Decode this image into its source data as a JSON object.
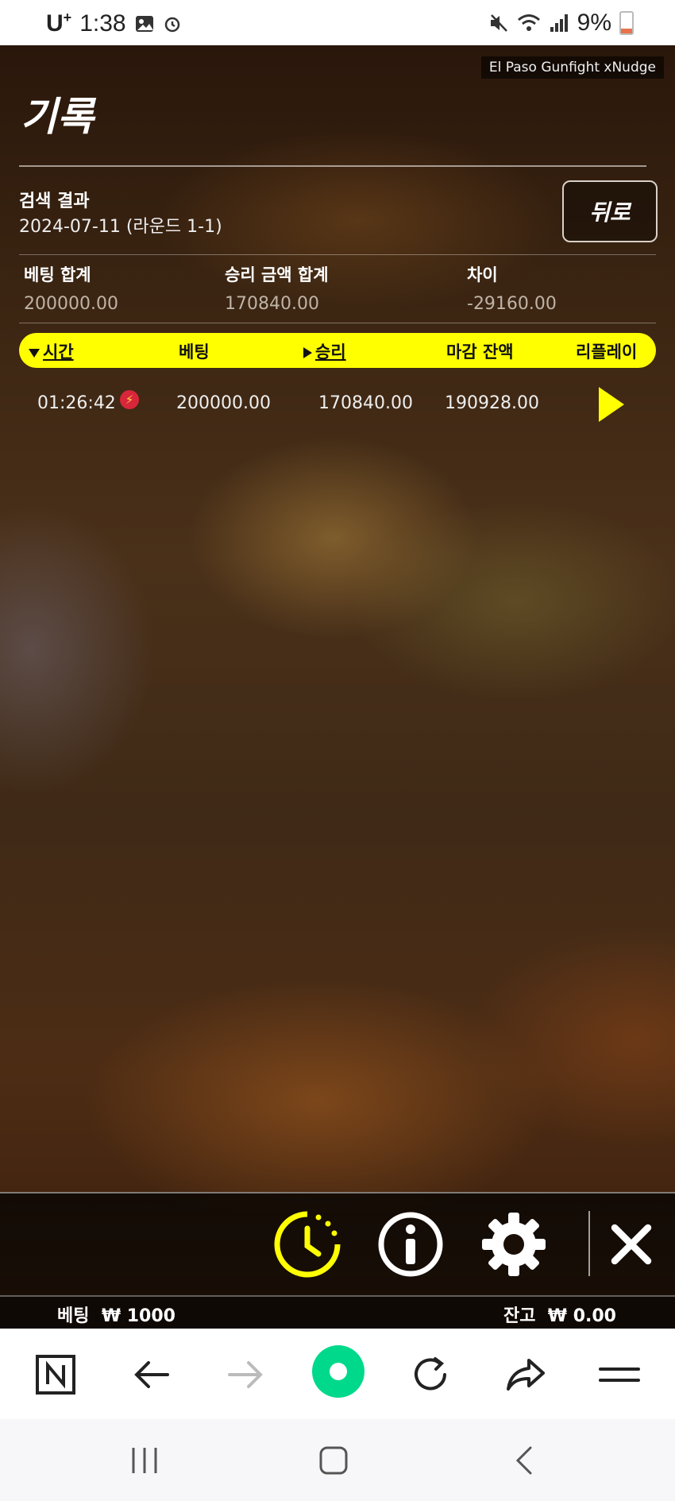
{
  "status_bar": {
    "carrier": "U",
    "carrier_sup": "+",
    "time": "1:38",
    "battery": "9%"
  },
  "game": {
    "label": "El Paso Gunfight xNudge",
    "title": "기록",
    "back_label": "뒤로",
    "search": {
      "label": "검색 결과",
      "value": "2024-07-11 (라운드 1-1)"
    },
    "summary": {
      "bet_total_label": "베팅 합계",
      "bet_total": "200000.00",
      "win_total_label": "승리 금액 합계",
      "win_total": "170840.00",
      "diff_label": "차이",
      "diff": "-29160.00"
    },
    "table": {
      "headers": {
        "time": "시간",
        "bet": "베팅",
        "win": "승리",
        "balance": "마감 잔액",
        "replay": "리플레이"
      },
      "rows": [
        {
          "time": "01:26:42",
          "bet": "200000.00",
          "win": "170840.00",
          "balance": "190928.00"
        }
      ]
    },
    "footer": {
      "bet_label": "베팅",
      "bet_value": "₩ 1000",
      "balance_label": "잔고",
      "balance_value": "₩ 0.00"
    }
  },
  "colors": {
    "accent": "#ffff00",
    "bolt": "#d8263a",
    "browser_home": "#00d98b"
  },
  "icons": [
    "history-icon",
    "info-icon",
    "settings-icon",
    "close-icon",
    "naver-icon",
    "back-arrow-icon",
    "forward-arrow-icon",
    "home-icon",
    "refresh-icon",
    "share-icon",
    "menu-icon"
  ]
}
